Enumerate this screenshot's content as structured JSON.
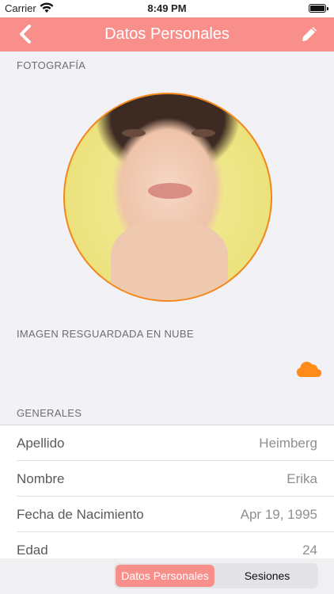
{
  "status_bar": {
    "carrier": "Carrier",
    "time": "8:49 PM"
  },
  "navbar": {
    "title": "Datos Personales",
    "back_icon": "chevron-left-icon",
    "edit_icon": "pencil-icon"
  },
  "sections": {
    "photo_header": "FOTOGRAFÍA",
    "cloud_header": "IMAGEN RESGUARDADA EN NUBE",
    "general_header": "GENERALES"
  },
  "cloud_icon_color": "#ff8c1a",
  "accent": "#f98f8a",
  "general_rows": [
    {
      "label": "Apellido",
      "value": "Heimberg"
    },
    {
      "label": "Nombre",
      "value": "Erika"
    },
    {
      "label": "Fecha de Nacimiento",
      "value": "Apr 19, 1995"
    },
    {
      "label": "Edad",
      "value": "24"
    }
  ],
  "segmented": {
    "options": [
      "Datos Personales",
      "Sesiones"
    ],
    "selected": "Datos Personales"
  }
}
